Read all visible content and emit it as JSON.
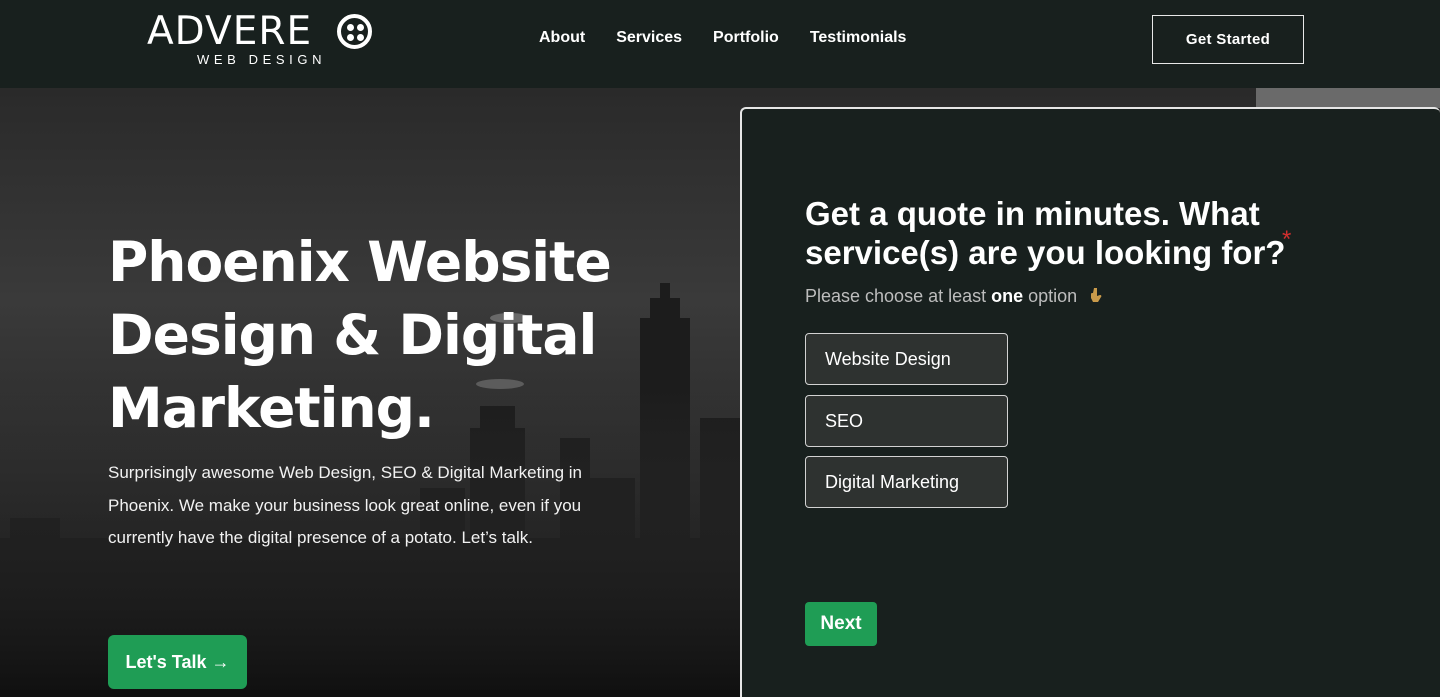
{
  "header": {
    "logo": {
      "word": "ADVERE",
      "subtitle": "WEB DESIGN"
    },
    "nav": [
      {
        "label": "About"
      },
      {
        "label": "Services"
      },
      {
        "label": "Portfolio"
      },
      {
        "label": "Testimonials"
      }
    ],
    "cta_label": "Get Started"
  },
  "hero": {
    "title": "Phoenix Website Design & Digital Marketing.",
    "description": "Surprisingly awesome Web Design, SEO & Digital Marketing in Phoenix. We make your business look great online, even if you currently have the digital presence of a potato. Let’s talk.",
    "button_label": "Let's Talk →"
  },
  "quote_form": {
    "question": "Get a quote in minutes. What service(s) are you looking for?",
    "required_marker": "*",
    "hint_prefix": "Please choose at least ",
    "hint_emphasis": "one",
    "hint_suffix": " option",
    "hint_icon": "pointing-down-hand-icon",
    "options": [
      {
        "label": "Website Design"
      },
      {
        "label": "SEO"
      },
      {
        "label": "Digital Marketing"
      }
    ],
    "next_label": "Next"
  },
  "colors": {
    "header_bg": "#18201e",
    "accent_green": "#1f9d55",
    "required_red": "#d12f2f",
    "option_bg": "#2e3230"
  }
}
